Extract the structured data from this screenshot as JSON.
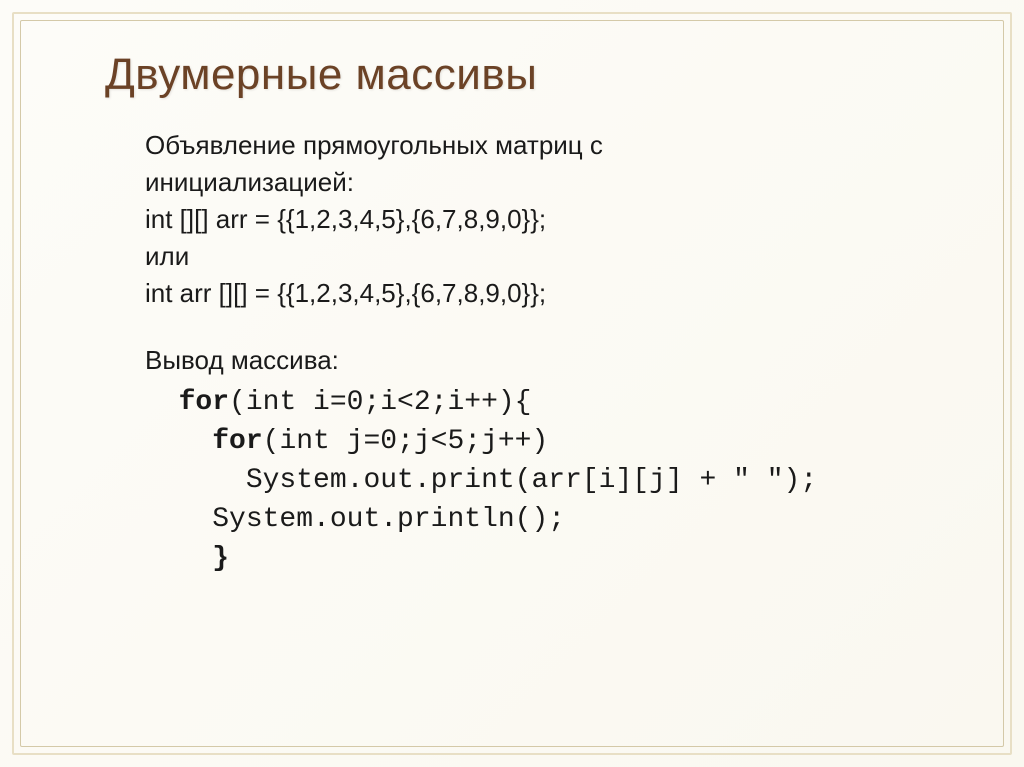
{
  "slide": {
    "title": "Двумерные массивы",
    "body": {
      "line1": "Объявление прямоугольных матриц с",
      "line2": "инициализацией:",
      "line3": "int [][] arr = {{1,2,3,4,5},{6,7,8,9,0}};",
      "line4": "или",
      "line5": "int arr [][] = {{1,2,3,4,5},{6,7,8,9,0}};",
      "line6": "Вывод массива:"
    },
    "code": {
      "kw_for1": "for",
      "l1_rest": "(int i=0;i<2;i++){",
      "kw_for2": "for",
      "l2_rest": "(int j=0;j<5;j++)",
      "l3": "System.out.print(arr[i][j] + \" \");",
      "l4": "System.out.println();",
      "kw_close": "}"
    }
  }
}
